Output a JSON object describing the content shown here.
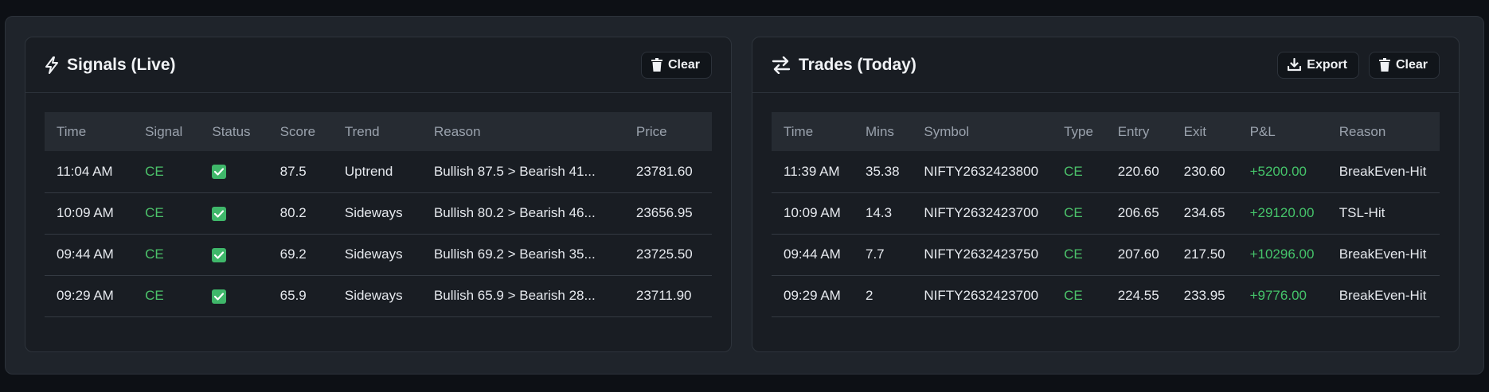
{
  "colors": {
    "accent_green": "#4cc26a",
    "check_green": "#3fb76a",
    "panel_bg": "#191d23",
    "header_row_bg": "#262b32"
  },
  "signals": {
    "title": "Signals (Live)",
    "title_icon": "lightning-bolt-icon",
    "clear_label": "Clear",
    "columns": [
      "Time",
      "Signal",
      "Status",
      "Score",
      "Trend",
      "Reason",
      "Price"
    ],
    "rows": [
      {
        "time": "11:04 AM",
        "signal": "CE",
        "status": "checked",
        "score": "87.5",
        "trend": "Uptrend",
        "reason": "Bullish 87.5 > Bearish 41...",
        "price": "23781.60"
      },
      {
        "time": "10:09 AM",
        "signal": "CE",
        "status": "checked",
        "score": "80.2",
        "trend": "Sideways",
        "reason": "Bullish 80.2 > Bearish 46...",
        "price": "23656.95"
      },
      {
        "time": "09:44 AM",
        "signal": "CE",
        "status": "checked",
        "score": "69.2",
        "trend": "Sideways",
        "reason": "Bullish 69.2 > Bearish 35...",
        "price": "23725.50"
      },
      {
        "time": "09:29 AM",
        "signal": "CE",
        "status": "checked",
        "score": "65.9",
        "trend": "Sideways",
        "reason": "Bullish 65.9 > Bearish 28...",
        "price": "23711.90"
      }
    ]
  },
  "trades": {
    "title": "Trades (Today)",
    "title_icon": "swap-arrows-icon",
    "export_label": "Export",
    "clear_label": "Clear",
    "columns": [
      "Time",
      "Mins",
      "Symbol",
      "Type",
      "Entry",
      "Exit",
      "P&L",
      "Reason"
    ],
    "rows": [
      {
        "time": "11:39 AM",
        "mins": "35.38",
        "symbol": "NIFTY2632423800",
        "type": "CE",
        "entry": "220.60",
        "exit": "230.60",
        "pnl": "+5200.00",
        "reason": "BreakEven-Hit"
      },
      {
        "time": "10:09 AM",
        "mins": "14.3",
        "symbol": "NIFTY2632423700",
        "type": "CE",
        "entry": "206.65",
        "exit": "234.65",
        "pnl": "+29120.00",
        "reason": "TSL-Hit"
      },
      {
        "time": "09:44 AM",
        "mins": "7.7",
        "symbol": "NIFTY2632423750",
        "type": "CE",
        "entry": "207.60",
        "exit": "217.50",
        "pnl": "+10296.00",
        "reason": "BreakEven-Hit"
      },
      {
        "time": "09:29 AM",
        "mins": "2",
        "symbol": "NIFTY2632423700",
        "type": "CE",
        "entry": "224.55",
        "exit": "233.95",
        "pnl": "+9776.00",
        "reason": "BreakEven-Hit"
      }
    ]
  }
}
